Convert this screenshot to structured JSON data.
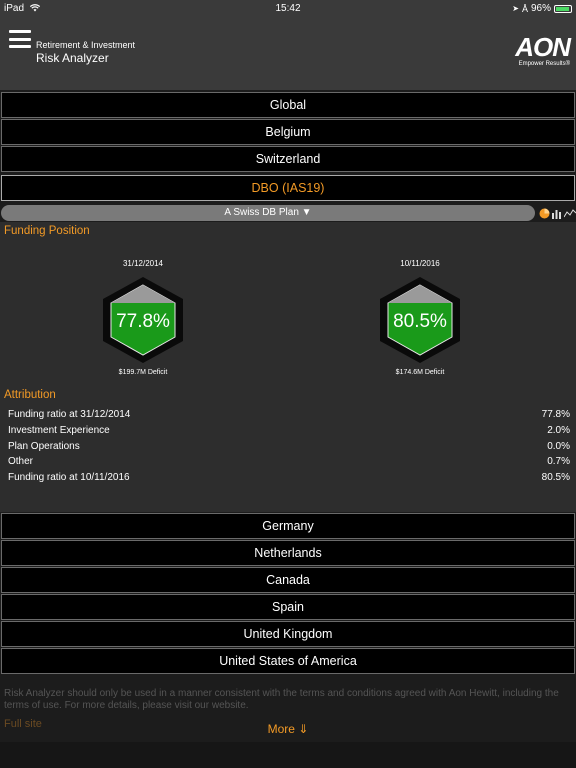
{
  "status_bar": {
    "device": "iPad",
    "time": "15:42",
    "battery": "96%",
    "battery_fraction": 0.96
  },
  "header": {
    "subtitle": "Retirement & Investment",
    "title": "Risk Analyzer",
    "logo_text": "AON",
    "logo_tagline": "Empower Results®"
  },
  "countries_top": [
    "Global",
    "Belgium",
    "Switzerland"
  ],
  "measure": "DBO (IAS19)",
  "plan_selector": "A Swiss DB Plan ▼",
  "funding": {
    "title": "Funding Position",
    "gauges": [
      {
        "date": "31/12/2014",
        "value": "77.8%",
        "deficit": "$199.7M Deficit"
      },
      {
        "date": "10/11/2016",
        "value": "80.5%",
        "deficit": "$174.6M Deficit"
      }
    ]
  },
  "attribution": {
    "title": "Attribution",
    "rows": [
      {
        "label": "Funding ratio at 31/12/2014",
        "value": "77.8%"
      },
      {
        "label": "Investment Experience",
        "value": "2.0%"
      },
      {
        "label": "Plan Operations",
        "value": "0.0%"
      },
      {
        "label": "Other",
        "value": "0.7%"
      },
      {
        "label": "Funding ratio at 10/11/2016",
        "value": "80.5%"
      }
    ]
  },
  "countries_bottom": [
    "Germany",
    "Netherlands",
    "Canada",
    "Spain",
    "United Kingdom",
    "United States of America"
  ],
  "footer": {
    "legal": "Risk Analyzer should only be used in a manner consistent with the terms and conditions agreed with Aon Hewitt, including the terms of use. For more details, please visit our website.",
    "full_site": "Full site",
    "more": "More ⇓"
  },
  "colors": {
    "accent": "#f29a26",
    "gauge_green": "#1a9a1a",
    "gauge_grey": "#9a9a9a"
  },
  "icons": [
    "menu-icon",
    "wifi-icon",
    "bluetooth-icon",
    "battery-icon",
    "pie-chart-icon",
    "bar-chart-icon",
    "line-chart-icon"
  ]
}
